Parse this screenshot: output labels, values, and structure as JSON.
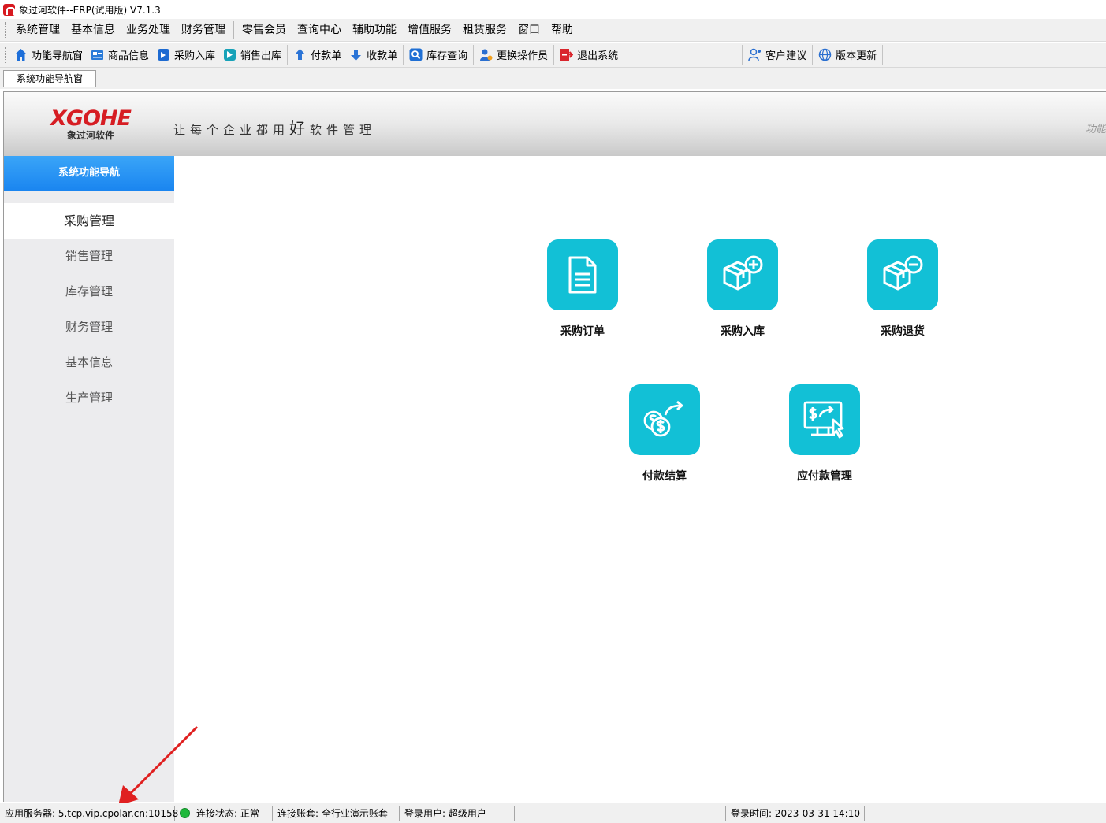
{
  "window": {
    "title": "象过河软件--ERP(试用版) V7.1.3"
  },
  "menu": [
    "系统管理",
    "基本信息",
    "业务处理",
    "财务管理",
    "零售会员",
    "查询中心",
    "辅助功能",
    "增值服务",
    "租赁服务",
    "窗口",
    "帮助"
  ],
  "toolbar": {
    "nav": "功能导航窗",
    "goods": "商品信息",
    "purchase_in": "采购入库",
    "sales_out": "销售出库",
    "payment": "付款单",
    "receipt": "收款单",
    "stock_query": "库存查询",
    "switch_operator": "更换操作员",
    "exit": "退出系统",
    "feedback": "客户建议",
    "update": "版本更新"
  },
  "doc_tab": "系统功能导航窗",
  "banner": {
    "logo": "XGOHE",
    "logo_sub": "象过河软件",
    "slogan_pre": "让每个企业都用",
    "slogan_big": "好",
    "slogan_post": "软件管理",
    "right_text": "功能"
  },
  "sidebar": {
    "header": "系统功能导航",
    "items": [
      "采购管理",
      "销售管理",
      "库存管理",
      "财务管理",
      "基本信息",
      "生产管理"
    ],
    "active": "采购管理"
  },
  "functions": [
    {
      "label": "采购订单",
      "icon": "document-icon"
    },
    {
      "label": "采购入库",
      "icon": "box-plus-icon"
    },
    {
      "label": "采购退货",
      "icon": "box-minus-icon"
    },
    {
      "label": "付款结算",
      "icon": "coins-transfer-icon"
    },
    {
      "label": "应付款管理",
      "icon": "monitor-payment-icon"
    }
  ],
  "status": {
    "server": "应用服务器: 5.tcp.vip.cpolar.cn:10158",
    "connection": "连接状态: 正常",
    "account": "连接账套: 全行业演示账套",
    "user": "登录用户: 超级用户",
    "login_time": "登录时间: 2023-03-31 14:10"
  },
  "colors": {
    "tile": "#12c0d6",
    "sidebar_header": "#1a85f0",
    "logo": "#d61d23",
    "annotation_arrow": "#e02020"
  }
}
